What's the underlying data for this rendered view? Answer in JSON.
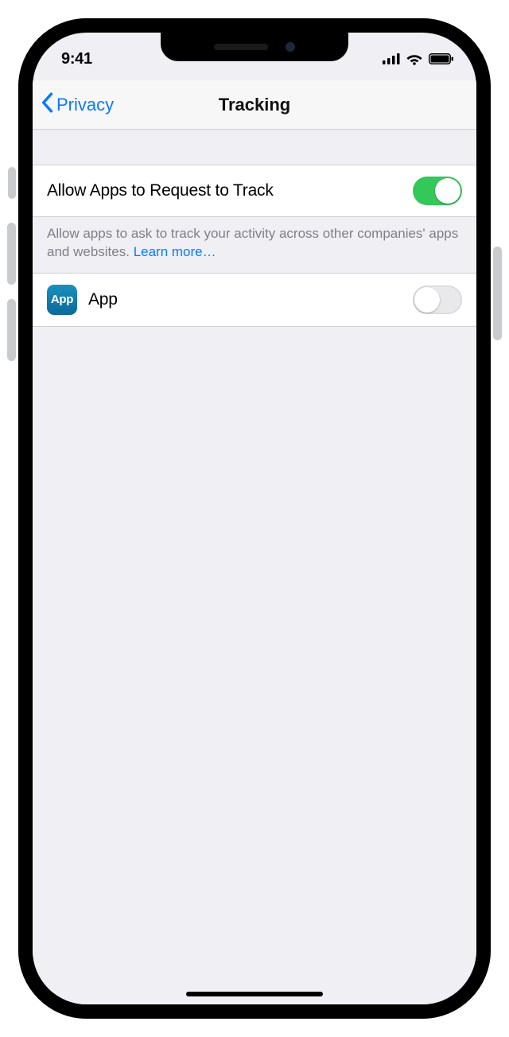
{
  "status": {
    "time": "9:41"
  },
  "nav": {
    "back_label": "Privacy",
    "title": "Tracking"
  },
  "settings": {
    "allow_request": {
      "label": "Allow Apps to Request to Track",
      "enabled": true
    },
    "footer_text": "Allow apps to ask to track your activity across other companies' apps and websites. ",
    "learn_more_label": "Learn more…"
  },
  "apps": [
    {
      "name": "App",
      "icon_text": "App",
      "tracking_enabled": false
    }
  ]
}
